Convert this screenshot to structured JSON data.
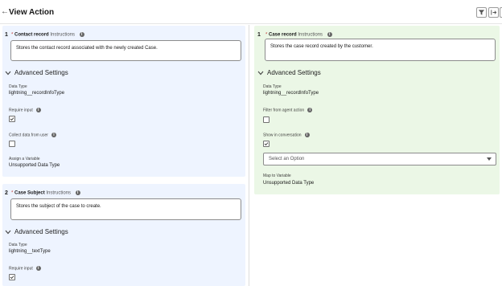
{
  "header": {
    "title": "View Action"
  },
  "inputs": [
    {
      "number": "1",
      "required_mark": "*",
      "label": "Contact record",
      "sub_label": "Instructions",
      "instructions": "Stores the contact record associated with the newly created Case.",
      "advanced_title": "Advanced Settings",
      "data_type_label": "Data Type",
      "data_type_value": "lightning__recordInfoType",
      "require_input_label": "Require input",
      "require_input_checked": true,
      "collect_label": "Collect data from user",
      "collect_checked": false,
      "assign_label": "Assign a Variable",
      "assign_value": "Unsupported Data Type"
    },
    {
      "number": "2",
      "required_mark": "*",
      "label": "Case Subject",
      "sub_label": "Instructions",
      "instructions": "Stores the subject of the case to create.",
      "advanced_title": "Advanced Settings",
      "data_type_label": "Data Type",
      "data_type_value": "lightning__textType",
      "require_input_label": "Require input",
      "require_input_checked": true
    }
  ],
  "outputs": [
    {
      "number": "1",
      "required_mark": "*",
      "label": "Case record",
      "sub_label": "Instructions",
      "instructions": "Stores the case record created by the customer.",
      "advanced_title": "Advanced Settings",
      "data_type_label": "Data Type",
      "data_type_value": "lightning__recordInfoType",
      "filter_label": "Filter from agent action",
      "filter_checked": false,
      "show_label": "Show in conversation",
      "show_checked": true,
      "select_placeholder": "Select an Option",
      "map_label": "Map to Variable",
      "map_value": "Unsupported Data Type"
    }
  ],
  "icons": {
    "back": "arrow-left-icon",
    "filter": "filter-icon",
    "expand": "expand-icon",
    "info": "info-icon",
    "chevron": "chevron-down-icon",
    "check": "check-icon"
  },
  "colors": {
    "input_panel_bg": "#eef4ff",
    "output_panel_bg": "#ebf7e6",
    "required": "#c23934",
    "border": "#8c8c8c"
  }
}
